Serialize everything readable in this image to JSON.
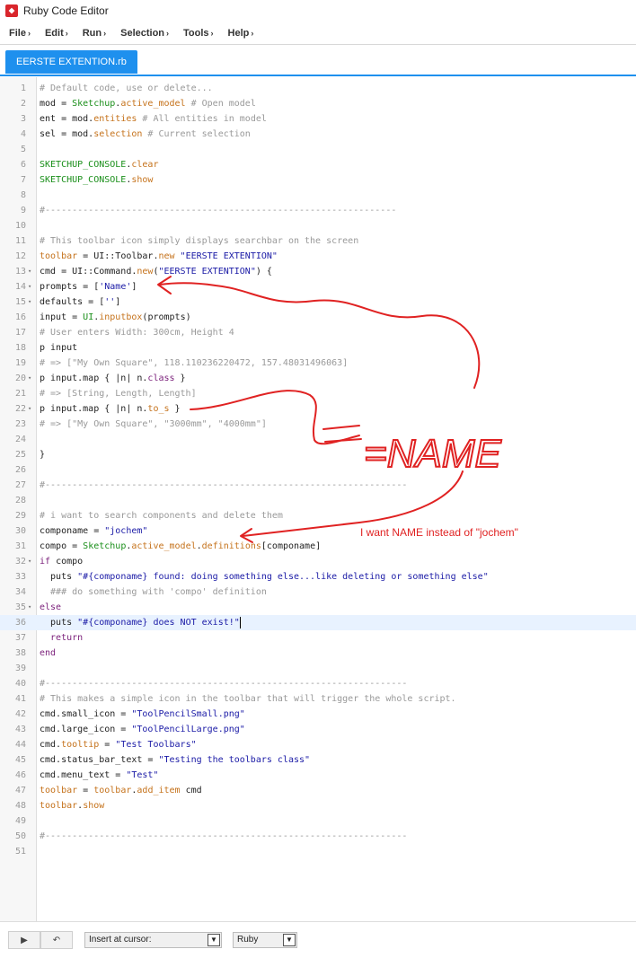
{
  "window": {
    "title": "Ruby Code Editor",
    "icon": "sketchup-icon"
  },
  "menu": [
    {
      "label": "File"
    },
    {
      "label": "Edit"
    },
    {
      "label": "Run"
    },
    {
      "label": "Selection"
    },
    {
      "label": "Tools"
    },
    {
      "label": "Help"
    }
  ],
  "menu_chevron": "›",
  "tabs": [
    {
      "label": "EERSTE EXTENTION.rb",
      "active": true
    }
  ],
  "colors": {
    "tab_accent": "#1e90ee",
    "comment": "#999999",
    "string": "#1a1aa6",
    "method": "#c5721b",
    "constant": "#1a8f1a",
    "keyword": "#7a1f7a",
    "annotation": "#e02222"
  },
  "code": {
    "active_line": 36,
    "lines": [
      {
        "n": "1",
        "fold": "",
        "segs": [
          [
            "com",
            "# Default code, use or delete..."
          ]
        ]
      },
      {
        "n": "2",
        "fold": "",
        "segs": [
          [
            "var",
            "mod = "
          ],
          [
            "con",
            "Sketchup"
          ],
          [
            "punct",
            "."
          ],
          [
            "mth",
            "active_model"
          ],
          [
            "com",
            " # Open model"
          ]
        ]
      },
      {
        "n": "3",
        "fold": "",
        "segs": [
          [
            "var",
            "ent = mod."
          ],
          [
            "mth",
            "entities"
          ],
          [
            "com",
            " # All entities in model"
          ]
        ]
      },
      {
        "n": "4",
        "fold": "",
        "segs": [
          [
            "var",
            "sel = mod."
          ],
          [
            "mth",
            "selection"
          ],
          [
            "com",
            " # Current selection"
          ]
        ]
      },
      {
        "n": "5",
        "fold": "",
        "segs": []
      },
      {
        "n": "6",
        "fold": "",
        "segs": [
          [
            "con",
            "SKETCHUP_CONSOLE"
          ],
          [
            "punct",
            "."
          ],
          [
            "mth",
            "clear"
          ]
        ]
      },
      {
        "n": "7",
        "fold": "",
        "segs": [
          [
            "con",
            "SKETCHUP_CONSOLE"
          ],
          [
            "punct",
            "."
          ],
          [
            "mth",
            "show"
          ]
        ]
      },
      {
        "n": "8",
        "fold": "",
        "segs": []
      },
      {
        "n": "9",
        "fold": "",
        "segs": [
          [
            "com",
            "#-----------------------------------------------------------------"
          ]
        ]
      },
      {
        "n": "10",
        "fold": "",
        "segs": []
      },
      {
        "n": "11",
        "fold": "",
        "segs": [
          [
            "com",
            "# This toolbar icon simply displays searchbar on the screen"
          ]
        ]
      },
      {
        "n": "12",
        "fold": "",
        "segs": [
          [
            "mth",
            "toolbar"
          ],
          [
            "var",
            " = UI::Toolbar."
          ],
          [
            "mth",
            "new"
          ],
          [
            "str",
            " \"EERSTE EXTENTION\""
          ]
        ]
      },
      {
        "n": "13",
        "fold": "▾",
        "segs": [
          [
            "var",
            "cmd = UI::Command."
          ],
          [
            "mth",
            "new"
          ],
          [
            "punct",
            "("
          ],
          [
            "str",
            "\"EERSTE EXTENTION\""
          ],
          [
            "punct",
            ") {"
          ]
        ]
      },
      {
        "n": "14",
        "fold": "▾",
        "segs": [
          [
            "var",
            "prompts = ["
          ],
          [
            "str",
            "'Name'"
          ],
          [
            "punct",
            "]"
          ]
        ]
      },
      {
        "n": "15",
        "fold": "▾",
        "segs": [
          [
            "var",
            "defaults = ["
          ],
          [
            "str",
            "''"
          ],
          [
            "punct",
            "]"
          ]
        ]
      },
      {
        "n": "16",
        "fold": "",
        "segs": [
          [
            "var",
            "input = "
          ],
          [
            "con",
            "UI"
          ],
          [
            "punct",
            "."
          ],
          [
            "mth",
            "inputbox"
          ],
          [
            "punct",
            "(prompts)"
          ]
        ]
      },
      {
        "n": "17",
        "fold": "",
        "segs": [
          [
            "com",
            "# User enters Width: 300cm, Height 4"
          ]
        ]
      },
      {
        "n": "18",
        "fold": "",
        "segs": [
          [
            "var",
            "p input"
          ]
        ]
      },
      {
        "n": "19",
        "fold": "",
        "segs": [
          [
            "com",
            "# => [\"My Own Square\", 118.110236220472, 157.48031496063]"
          ]
        ]
      },
      {
        "n": "20",
        "fold": "▾",
        "segs": [
          [
            "var",
            "p input.map { |n| n."
          ],
          [
            "kw",
            "class"
          ],
          [
            "punct",
            " }"
          ]
        ]
      },
      {
        "n": "21",
        "fold": "",
        "segs": [
          [
            "com",
            "# => [String, Length, Length]"
          ]
        ]
      },
      {
        "n": "22",
        "fold": "▾",
        "segs": [
          [
            "var",
            "p input.map { |n| n."
          ],
          [
            "mth",
            "to_s"
          ],
          [
            "punct",
            " }"
          ]
        ]
      },
      {
        "n": "23",
        "fold": "",
        "segs": [
          [
            "com",
            "# => [\"My Own Square\", \"3000mm\", \"4000mm\"]"
          ]
        ]
      },
      {
        "n": "24",
        "fold": "",
        "segs": []
      },
      {
        "n": "25",
        "fold": "",
        "segs": [
          [
            "punct",
            "}"
          ]
        ]
      },
      {
        "n": "26",
        "fold": "",
        "segs": []
      },
      {
        "n": "27",
        "fold": "",
        "segs": [
          [
            "com",
            "#-------------------------------------------------------------------"
          ]
        ]
      },
      {
        "n": "28",
        "fold": "",
        "segs": []
      },
      {
        "n": "29",
        "fold": "",
        "segs": [
          [
            "com",
            "# i want to search components and delete them"
          ]
        ]
      },
      {
        "n": "30",
        "fold": "",
        "segs": [
          [
            "var",
            "componame = "
          ],
          [
            "str",
            "\"jochem\""
          ]
        ]
      },
      {
        "n": "31",
        "fold": "",
        "segs": [
          [
            "var",
            "compo = "
          ],
          [
            "con",
            "Sketchup"
          ],
          [
            "punct",
            "."
          ],
          [
            "mth",
            "active_model"
          ],
          [
            "punct",
            "."
          ],
          [
            "mth",
            "definitions"
          ],
          [
            "punct",
            "[componame]"
          ]
        ]
      },
      {
        "n": "32",
        "fold": "▾",
        "segs": [
          [
            "kw",
            "if"
          ],
          [
            "var",
            " compo"
          ]
        ]
      },
      {
        "n": "33",
        "fold": "",
        "segs": [
          [
            "var",
            "  puts "
          ],
          [
            "str",
            "\"#{componame} found: doing something else...like deleting or something else\""
          ]
        ]
      },
      {
        "n": "34",
        "fold": "",
        "segs": [
          [
            "com",
            "  ### do something with 'compo' definition"
          ]
        ]
      },
      {
        "n": "35",
        "fold": "▾",
        "segs": [
          [
            "kw",
            "else"
          ]
        ]
      },
      {
        "n": "36",
        "fold": "",
        "segs": [
          [
            "var",
            "  puts "
          ],
          [
            "str",
            "\"#{componame} does NOT exist!\""
          ]
        ]
      },
      {
        "n": "37",
        "fold": "",
        "segs": [
          [
            "kw",
            "  return"
          ]
        ]
      },
      {
        "n": "38",
        "fold": "",
        "segs": [
          [
            "kw",
            "end"
          ]
        ]
      },
      {
        "n": "39",
        "fold": "",
        "segs": []
      },
      {
        "n": "40",
        "fold": "",
        "segs": [
          [
            "com",
            "#-------------------------------------------------------------------"
          ]
        ]
      },
      {
        "n": "41",
        "fold": "",
        "segs": [
          [
            "com",
            "# This makes a simple icon in the toolbar that will trigger the whole script."
          ]
        ]
      },
      {
        "n": "42",
        "fold": "",
        "segs": [
          [
            "var",
            "cmd.small_icon = "
          ],
          [
            "str",
            "\"ToolPencilSmall.png\""
          ]
        ]
      },
      {
        "n": "43",
        "fold": "",
        "segs": [
          [
            "var",
            "cmd.large_icon = "
          ],
          [
            "str",
            "\"ToolPencilLarge.png\""
          ]
        ]
      },
      {
        "n": "44",
        "fold": "",
        "segs": [
          [
            "var",
            "cmd."
          ],
          [
            "mth",
            "tooltip"
          ],
          [
            "var",
            " = "
          ],
          [
            "str",
            "\"Test Toolbars\""
          ]
        ]
      },
      {
        "n": "45",
        "fold": "",
        "segs": [
          [
            "var",
            "cmd.status_bar_text = "
          ],
          [
            "str",
            "\"Testing the toolbars class\""
          ]
        ]
      },
      {
        "n": "46",
        "fold": "",
        "segs": [
          [
            "var",
            "cmd.menu_text = "
          ],
          [
            "str",
            "\"Test\""
          ]
        ]
      },
      {
        "n": "47",
        "fold": "",
        "segs": [
          [
            "mth",
            "toolbar"
          ],
          [
            "var",
            " = "
          ],
          [
            "mth",
            "toolbar"
          ],
          [
            "punct",
            "."
          ],
          [
            "mth",
            "add_item"
          ],
          [
            "var",
            " cmd"
          ]
        ]
      },
      {
        "n": "48",
        "fold": "",
        "segs": [
          [
            "mth",
            "toolbar"
          ],
          [
            "punct",
            "."
          ],
          [
            "mth",
            "show"
          ]
        ]
      },
      {
        "n": "49",
        "fold": "",
        "segs": []
      },
      {
        "n": "50",
        "fold": "",
        "segs": [
          [
            "com",
            "#-------------------------------------------------------------------"
          ]
        ]
      },
      {
        "n": "51",
        "fold": "",
        "segs": []
      }
    ]
  },
  "annotation": {
    "handwritten": "=NAME",
    "note": "I want NAME instead of    \"jochem\""
  },
  "bottom": {
    "run_icon": "play-icon",
    "undo_icon": "undo-icon",
    "insert_select": "Insert at cursor:",
    "language_select": "Ruby"
  }
}
